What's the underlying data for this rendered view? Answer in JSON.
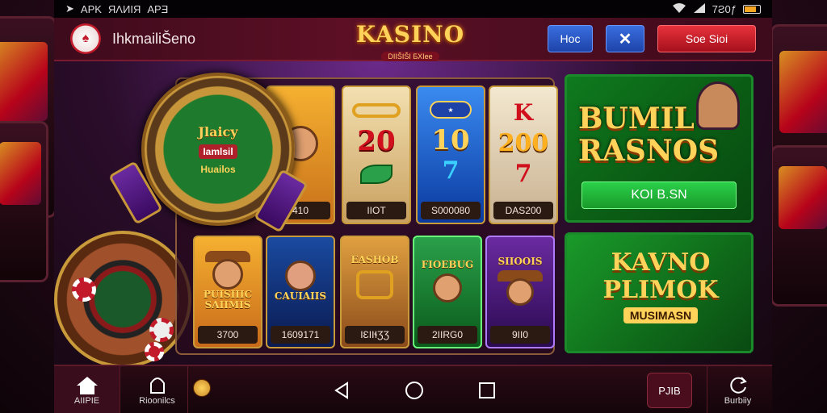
{
  "status_bar": {
    "left_text": "APK",
    "left_text_2": "ЯΛИIЯ",
    "left_text_3": "APƎ",
    "time": "7Ƨ0ƒ"
  },
  "header": {
    "app_name": "IhkmailiŠeno",
    "brand_main": "KASINO",
    "brand_sub": "DІІŠІŠІ БХІее",
    "btn_blue": "Hoc",
    "btn_x": "✕",
    "btn_red": "Soe Sioi"
  },
  "wheel": {
    "top": "Jlaicy",
    "mid": "Iamlsil",
    "bottom": "Huailos"
  },
  "cards_top": [
    {
      "art": "face",
      "label": "410"
    },
    {
      "art": "20",
      "label": "IIOT"
    },
    {
      "art": "10",
      "label": "S000080"
    },
    {
      "art": "200",
      "label": "DAS200"
    }
  ],
  "cards_bottom": [
    {
      "title": "PUISIIIC SAIIMIS",
      "label": "3700"
    },
    {
      "title": "CAUIAIIS",
      "label": "1609171"
    },
    {
      "title": "EASHOB",
      "label": "IƐIIɬƷƷ"
    },
    {
      "title": "FIOEBUG",
      "label": "2IIRG0"
    },
    {
      "title": "SIIOOIS",
      "label": "9II0"
    }
  ],
  "banner_top": {
    "headline_1": "BUMIL",
    "headline_2": "RASNOS",
    "cta": "KOI B.SN"
  },
  "banner_bottom": {
    "line_1": "KAVNO",
    "line_2": "PLIMOK",
    "line_3": "MUSIMASN"
  },
  "bottom_nav": {
    "home_label": "AIIPIE",
    "casinos_label": "Rioonilcs",
    "pill_label": "PJIB",
    "history_label": "Burbiiy"
  },
  "colors": {
    "accent_gold": "#ffd35a",
    "accent_red": "#c21a2a",
    "accent_green": "#1a9a2a",
    "accent_blue": "#1d43a8"
  }
}
